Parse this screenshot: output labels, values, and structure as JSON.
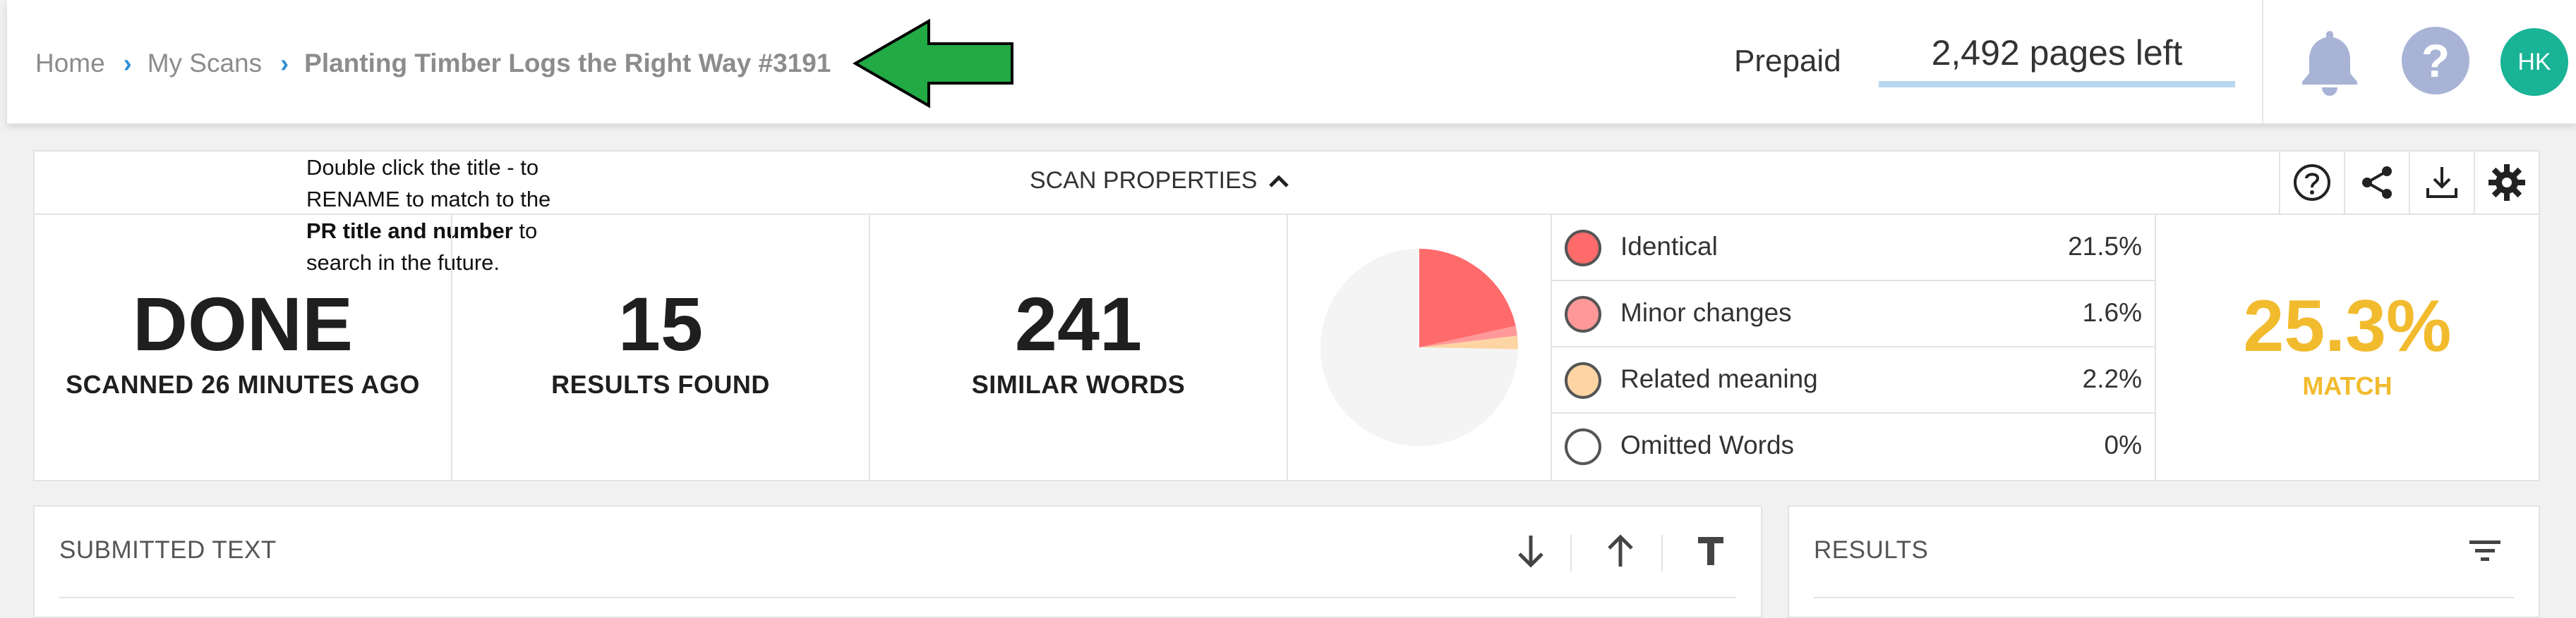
{
  "breadcrumb": {
    "home": "Home",
    "my_scans": "My Scans",
    "current": "Planting Timber Logs the Right Way #3191"
  },
  "header": {
    "plan": "Prepaid",
    "pages_left": "2,492 pages left",
    "pages_left_fraction": 1.0,
    "avatar_initials": "HK",
    "help_glyph": "?",
    "icons": [
      "bell-icon",
      "help-icon"
    ]
  },
  "annotation": {
    "line1": "Double click the title - to",
    "line2": "RENAME to match to the",
    "line3_bold": "PR title and number",
    "line3_rest": " to",
    "line4": "search in the future."
  },
  "scan_properties": {
    "title": "SCAN PROPERTIES",
    "tools": [
      "help-circle-icon",
      "share-icon",
      "download-icon",
      "settings-icon"
    ],
    "status": {
      "value": "DONE",
      "label": "SCANNED 26 MINUTES AGO"
    },
    "results": {
      "value": "15",
      "label": "RESULTS FOUND"
    },
    "similar": {
      "value": "241",
      "label": "SIMILAR WORDS"
    },
    "legend": [
      {
        "label": "Identical",
        "pct": "21.5%",
        "color": "#ff6b6b"
      },
      {
        "label": "Minor changes",
        "pct": "1.6%",
        "color": "#ff9999"
      },
      {
        "label": "Related meaning",
        "pct": "2.2%",
        "color": "#fdd5a3"
      },
      {
        "label": "Omitted Words",
        "pct": "0%",
        "color": "#ffffff"
      }
    ],
    "match": {
      "value": "25.3%",
      "label": "MATCH"
    }
  },
  "chart_data": {
    "type": "pie",
    "categories": [
      "Identical",
      "Minor changes",
      "Related meaning",
      "Omitted Words",
      "Remaining"
    ],
    "values": [
      21.5,
      1.6,
      2.2,
      0,
      74.7
    ],
    "colors": [
      "#ff6b6b",
      "#ff9999",
      "#fdd5a3",
      "#ffffff",
      "#f4f4f4"
    ]
  },
  "submitted_text": {
    "title": "SUBMITTED TEXT"
  },
  "results_panel": {
    "title": "RESULTS"
  },
  "colors": {
    "accent": "#2d8fd5",
    "match": "#f2bb2e",
    "avatar": "#19b395",
    "arrow": "#22aa44"
  }
}
